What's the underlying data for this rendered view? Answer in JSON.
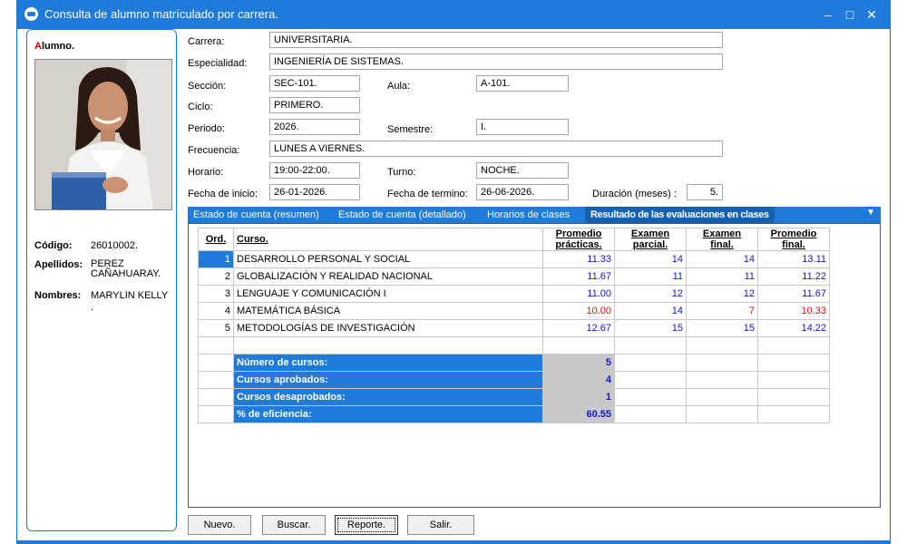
{
  "window": {
    "title": "Consulta de alumno matrículado por carrera.",
    "minimize": "–",
    "maximize": "□",
    "close": "✕"
  },
  "student": {
    "section_label": "Alumno.",
    "codigo_label": "Código:",
    "codigo": "26010002.",
    "apellidos_label": "Apellidos:",
    "apellidos": "PEREZ CAÑAHUARAY.",
    "nombres_label": "Nombres:",
    "nombres": "MARYLIN KELLY ."
  },
  "fields": {
    "carrera_label": "Carrera:",
    "carrera": "UNIVERSITARIA.",
    "especialidad_label": "Especialidad:",
    "especialidad": "INGENIERÍA DE SISTEMAS.",
    "seccion_label": "Sección:",
    "seccion": "SEC-101.",
    "aula_label": "Aula:",
    "aula": "A-101.",
    "ciclo_label": "Ciclo:",
    "ciclo": "PRIMERO.",
    "periodo_label": "Periodo:",
    "periodo": "2026.",
    "semestre_label": "Semestre:",
    "semestre": "I.",
    "frecuencia_label": "Frecuencia:",
    "frecuencia": "LUNES A VIERNES.",
    "horario_label": "Horario:",
    "horario": "19:00-22:00.",
    "turno_label": "Turno:",
    "turno": "NOCHE.",
    "fecha_inicio_label": "Fecha de inicio:",
    "fecha_inicio": "26-01-2026.",
    "fecha_termino_label": "Fecha de termino:",
    "fecha_termino": "26-06-2026.",
    "duracion_label": "Duración (meses) :",
    "duracion": "5."
  },
  "tabs": [
    "Estado de cuenta (resumen)",
    "Estado de cuenta (detallado)",
    "Horarios de clases",
    "Resultado de las evaluaciones en clases"
  ],
  "grid": {
    "headers": {
      "ord": "Ord.",
      "curso": "Curso.",
      "pp1": "Promedio",
      "pp2": "prácticas.",
      "ep1": "Examen",
      "ep2": "parcial.",
      "ef1": "Examen",
      "ef2": "final.",
      "pf1": "Promedio",
      "pf2": "final."
    },
    "rows": [
      {
        "ord": "1",
        "curso": "DESARROLLO PERSONAL Y SOCIAL",
        "pp": "11.33",
        "ep": "14",
        "ef": "14",
        "pf": "13.11"
      },
      {
        "ord": "2",
        "curso": "GLOBALIZACIÓN Y REALIDAD NACIONAL",
        "pp": "11.67",
        "ep": "11",
        "ef": "11",
        "pf": "11.22"
      },
      {
        "ord": "3",
        "curso": "LENGUAJE Y COMUNICACIÓN I",
        "pp": "11.00",
        "ep": "12",
        "ef": "12",
        "pf": "11.67"
      },
      {
        "ord": "4",
        "curso": "MATEMÁTICA BÁSICA",
        "pp": "10.00",
        "ep": "14",
        "ef": "7",
        "pf": "10.33"
      },
      {
        "ord": "5",
        "curso": "METODOLOGÍAS DE INVESTIGACIÓN",
        "pp": "12.67",
        "ep": "15",
        "ef": "15",
        "pf": "14.22"
      }
    ],
    "summary": {
      "num_cursos_label": "Número de cursos:",
      "num_cursos": "5",
      "aprobados_label": "Cursos aprobados:",
      "aprobados": "4",
      "desaprobados_label": "Cursos desaprobados:",
      "desaprobados": "1",
      "eficiencia_label": "% de eficiencia:",
      "eficiencia": "60.55"
    }
  },
  "buttons": {
    "nuevo": "Nuevo.",
    "buscar": "Buscar.",
    "reporte": "Reporte.",
    "salir": "Salir."
  }
}
